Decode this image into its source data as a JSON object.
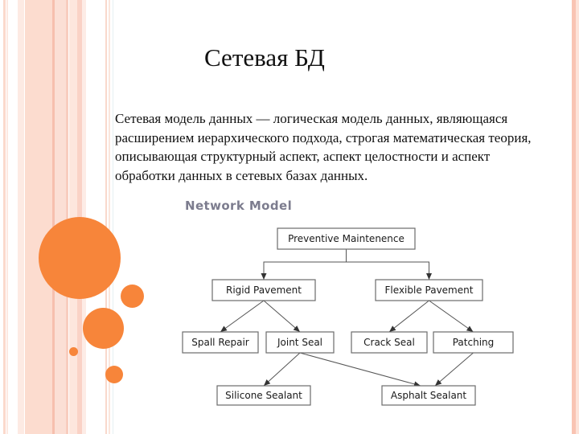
{
  "slide": {
    "title": "Сетевая БД",
    "body_lines": [
      "Сетевая модель данных — логическая модель данных, являющаяся",
      "расширением иерархического подхода, строгая математическая теория,",
      "описывающая структурный аспект, аспект целостности и аспект",
      "обработки данных в сетевых базах данных."
    ],
    "accent_color": "#f7853a"
  },
  "diagram": {
    "title": "Network Model",
    "nodes": [
      {
        "id": "pm",
        "label": "Preventive Maintenence"
      },
      {
        "id": "rigid",
        "label": "Rigid Pavement"
      },
      {
        "id": "flex",
        "label": "Flexible Pavement"
      },
      {
        "id": "spall",
        "label": "Spall Repair"
      },
      {
        "id": "joint",
        "label": "Joint Seal"
      },
      {
        "id": "crack",
        "label": "Crack Seal"
      },
      {
        "id": "patch",
        "label": "Patching"
      },
      {
        "id": "silicone",
        "label": "Silicone Sealant"
      },
      {
        "id": "asphalt",
        "label": "Asphalt Sealant"
      }
    ],
    "edges": [
      {
        "from": "pm",
        "to": "rigid"
      },
      {
        "from": "pm",
        "to": "flex"
      },
      {
        "from": "rigid",
        "to": "spall"
      },
      {
        "from": "rigid",
        "to": "joint"
      },
      {
        "from": "flex",
        "to": "crack"
      },
      {
        "from": "flex",
        "to": "patch"
      },
      {
        "from": "joint",
        "to": "silicone"
      },
      {
        "from": "joint",
        "to": "asphalt"
      },
      {
        "from": "patch",
        "to": "asphalt"
      }
    ]
  }
}
